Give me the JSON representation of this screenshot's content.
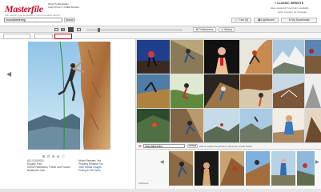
{
  "brand": {
    "logo_text": "Masterfile",
    "tagline_line1": "RIGHTS MANAGED",
    "tagline_line2": "AND ROYALTY-FREE IMAGES"
  },
  "header": {
    "classic_link": "» CLASSIC WEBSITE",
    "questions_text": "Have questions? Live help is available",
    "help_text": "Help | Contact | Us | Français",
    "cart_label": "Cart (0)",
    "lightboxes_label": "Lightboxes",
    "downloads_label": "My Downloads"
  },
  "search": {
    "hint": "Tab: search, type keywords or jump to another search",
    "value": "mountaineering",
    "button_label": "Search"
  },
  "toolbar": {
    "preferences_label": "Preferences",
    "history_label": "History"
  },
  "filters": {
    "all_images_label": "All Images",
    "all_images_count": "3000",
    "rm_label": "RM",
    "rm_count": "1034",
    "rf_label": "RF",
    "rf_count": "1923"
  },
  "preview": {
    "image_id": "613-01519003",
    "license": "Royalty-Free",
    "description": "Grenie Nelbossen, Fobbe and Fossed",
    "collection": "Belafonte Lines",
    "model_release": "Model Release: Yes",
    "property_release": "Property Release: No",
    "view_similar": "View Similar Images",
    "pricing": "Pricing & File Sizes"
  },
  "refine": {
    "keyword": "mountaineering",
    "button_label": "Refine",
    "hint": "Add or replace keywords to refine the results below"
  },
  "bottom_label": "Sortboard",
  "colors": {
    "brand_red": "#c8102e",
    "accent_red": "#cc0000",
    "text_gray": "#444444",
    "border_gray": "#bbbbbb"
  }
}
